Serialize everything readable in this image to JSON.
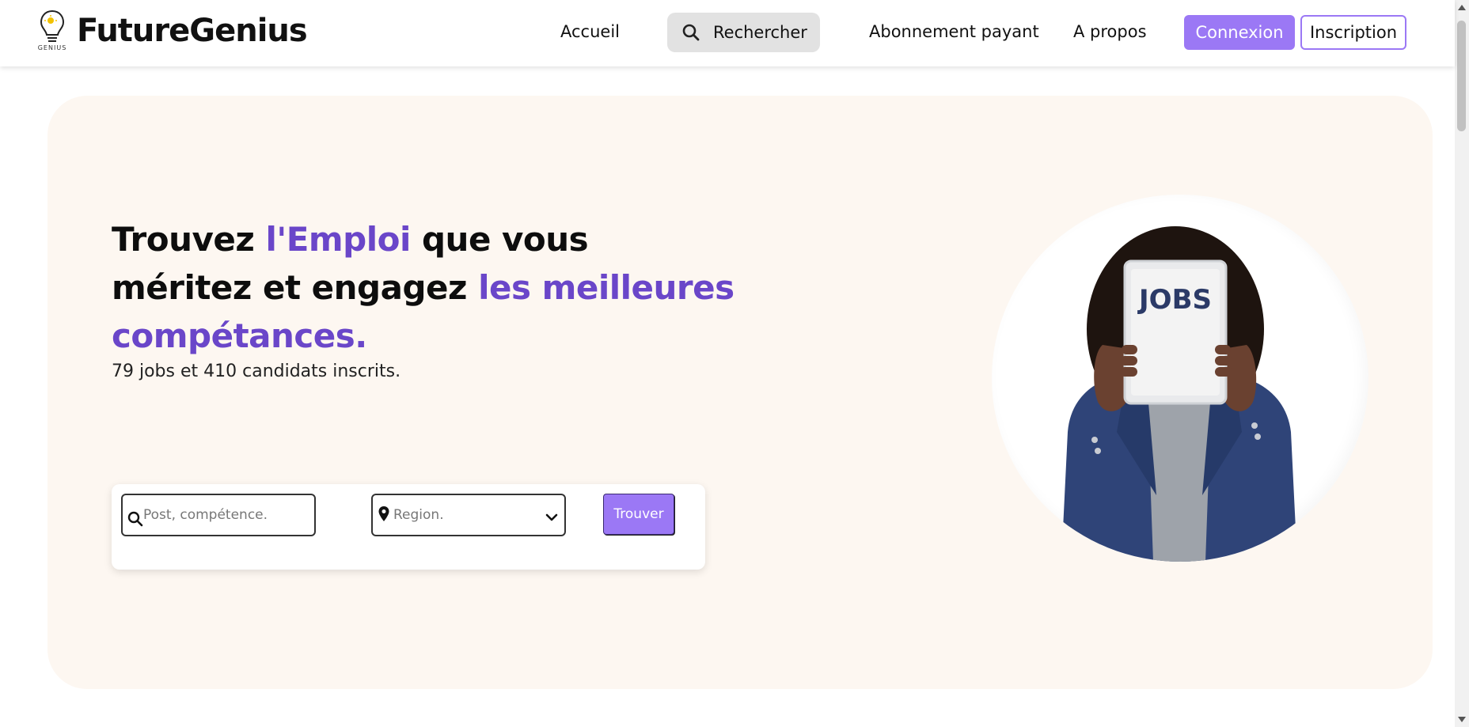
{
  "header": {
    "brand": "FutureGenius",
    "logo_caption": "GENIUS",
    "nav": {
      "home": "Accueil",
      "search": "Rechercher",
      "subscription": "Abonnement payant",
      "about": "A propos"
    },
    "login_label": "Connexion",
    "signup_label": "Inscription"
  },
  "hero": {
    "headline": {
      "part1": "Trouvez ",
      "accent1": "l'Emploi",
      "part2": " que vous méritez et engagez ",
      "accent2": "les meilleures compétances."
    },
    "stats": "79 jobs et 410 candidats inscrits.",
    "search": {
      "post_placeholder": "Post, compétence.",
      "region_placeholder": "Region.",
      "submit_label": "Trouver"
    },
    "illustration_text": "JOBS"
  },
  "colors": {
    "accent": "#6a46c9",
    "button": "#9b78f5",
    "hero_bg": "#fdf7f1"
  },
  "icons": [
    "lightbulb-logo-icon",
    "search-icon",
    "location-pin-icon",
    "chevron-down-icon"
  ]
}
